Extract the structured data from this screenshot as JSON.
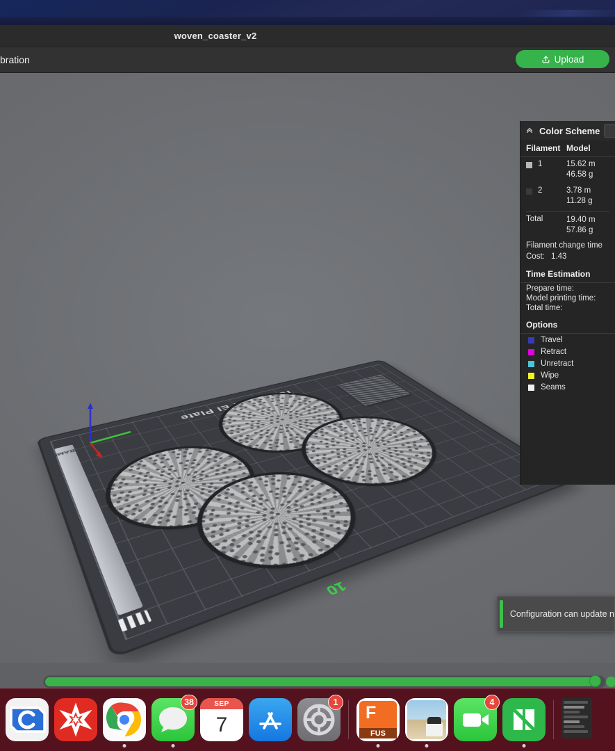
{
  "window": {
    "app_title": "woven_coaster_v2",
    "tab_label": "bration",
    "upload_label": "Upload",
    "upload_icon": "upload-arrow-icon"
  },
  "viewport": {
    "plate_label": "Textured PEI Plate",
    "plate_strip_text": "BAMBU",
    "axis_tick_label": "10",
    "gizmo": {
      "x_axis": "red",
      "y_axis": "green",
      "z_axis": "blue"
    },
    "coasters_count": 4,
    "wipe_tower_name": "prime-tower"
  },
  "toast": {
    "message": "Configuration can update n",
    "accent_color": "#3cc14a"
  },
  "panel": {
    "header": "Color Scheme",
    "collapse_icon": "chevron-up-icon",
    "columns": {
      "filament": "Filament",
      "model": "Model"
    },
    "filaments": [
      {
        "id": "1",
        "swatch": "#b8b8b8",
        "length": "15.62 m",
        "weight": "46.58 g"
      },
      {
        "id": "2",
        "swatch": "#3a3a3a",
        "length": "3.78 m",
        "weight": "11.28 g"
      }
    ],
    "total": {
      "label": "Total",
      "length": "19.40 m",
      "weight": "57.86 g"
    },
    "filament_change_label": "Filament change time",
    "cost_label": "Cost:",
    "cost_value": "1.43",
    "time_section": "Time Estimation",
    "times": [
      {
        "label": "Prepare time:",
        "value": ""
      },
      {
        "label": "Model printing time:",
        "value": ""
      },
      {
        "label": "Total time:",
        "value": ""
      }
    ],
    "options_section": "Options",
    "options": [
      {
        "label": "Travel",
        "color": "#3a3ab4"
      },
      {
        "label": "Retract",
        "color": "#e000e0"
      },
      {
        "label": "Unretract",
        "color": "#4fc3da"
      },
      {
        "label": "Wipe",
        "color": "#f2f224"
      },
      {
        "label": "Seams",
        "color": "#f0f0f0"
      }
    ]
  },
  "slider": {
    "name": "layer-slider",
    "fill_percent": 97,
    "color": "#3cb34a"
  },
  "dock": {
    "items": [
      {
        "name": "cura-icon",
        "label": "Cura",
        "badge": ""
      },
      {
        "name": "mathematica-icon",
        "label": "Mathematica",
        "badge": ""
      },
      {
        "name": "chrome-icon",
        "label": "Google Chrome",
        "badge": "",
        "running": true
      },
      {
        "name": "messages-icon",
        "label": "Messages",
        "badge": "38",
        "running": true
      },
      {
        "name": "calendar-icon",
        "label": "Calendar",
        "badge": "",
        "month": "SEP",
        "day": "7"
      },
      {
        "name": "app-store-icon",
        "label": "App Store",
        "badge": ""
      },
      {
        "name": "system-settings-icon",
        "label": "System Settings",
        "badge": "1"
      },
      {
        "name": "fusion-360-icon",
        "label": "FUS",
        "badge": "",
        "running": true
      },
      {
        "name": "preview-icon",
        "label": "Preview",
        "badge": "",
        "running": true
      },
      {
        "name": "facetime-icon",
        "label": "FaceTime",
        "badge": "4"
      },
      {
        "name": "bambu-studio-icon",
        "label": "Bambu Studio",
        "badge": "",
        "running": true
      },
      {
        "name": "minimized-window",
        "label": "Minimized Window",
        "badge": ""
      }
    ]
  }
}
